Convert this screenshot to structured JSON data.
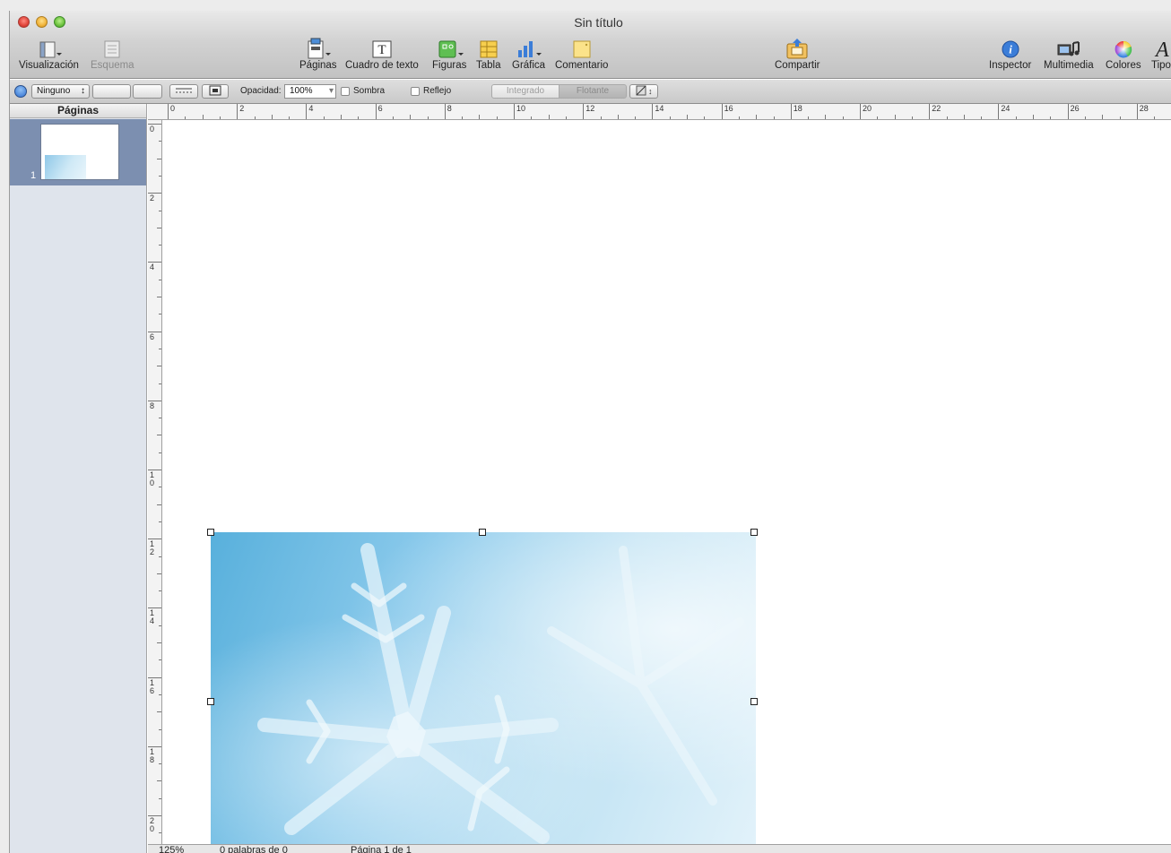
{
  "window": {
    "title": "Sin título"
  },
  "toolbar": {
    "visualizacion": "Visualización",
    "esquema": "Esquema",
    "paginas": "Páginas",
    "cuadro_texto": "Cuadro de texto",
    "figuras": "Figuras",
    "tabla": "Tabla",
    "grafica": "Gráfica",
    "comentario": "Comentario",
    "compartir": "Compartir",
    "inspector": "Inspector",
    "multimedia": "Multimedia",
    "colores": "Colores",
    "tipografia": "Tipo"
  },
  "formatbar": {
    "style_select": "Ninguno",
    "opacity_label": "Opacidad:",
    "opacity_value": "100%",
    "sombra_label": "Sombra",
    "reflejo_label": "Reflejo",
    "integrado": "Integrado",
    "flotante": "Flotante"
  },
  "sidebar": {
    "title": "Páginas",
    "pages": [
      {
        "number": "1"
      }
    ]
  },
  "rulers": {
    "horizontal": [
      "0",
      "2",
      "4",
      "6",
      "8",
      "10",
      "12",
      "14",
      "16",
      "18",
      "20",
      "22",
      "24",
      "26",
      "28"
    ],
    "vertical": [
      "0",
      "2",
      "4",
      "6",
      "8",
      "10",
      "12",
      "14",
      "16",
      "18",
      "20"
    ]
  },
  "statusbar": {
    "zoom": "125%",
    "words": "0 palabras de 0",
    "page": "Página 1 de 1"
  }
}
